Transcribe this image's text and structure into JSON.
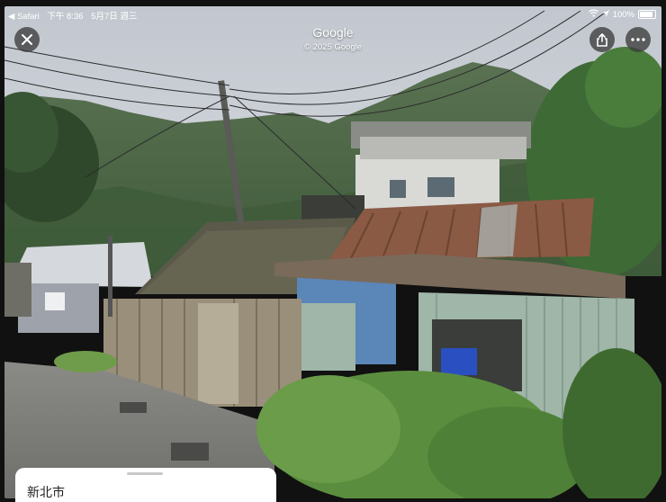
{
  "status_bar": {
    "back_app": "◀ Safari",
    "time": "下午 8:36",
    "date": "5月7日 週三",
    "battery": "100%"
  },
  "header": {
    "title": "Google",
    "copyright": "© 2025 Google"
  },
  "buttons": {
    "close": "close-icon",
    "share": "share-icon",
    "more": "more-icon"
  },
  "bottom_sheet": {
    "place_name": "新北市"
  },
  "colors": {
    "sky": "#c9ced6",
    "mountain": "#4f6a45",
    "roof_rust": "#8a5a44",
    "fence": "#9a8f7a",
    "corrugated_green": "#9fb6a8",
    "blue_wall": "#5b86b8"
  }
}
